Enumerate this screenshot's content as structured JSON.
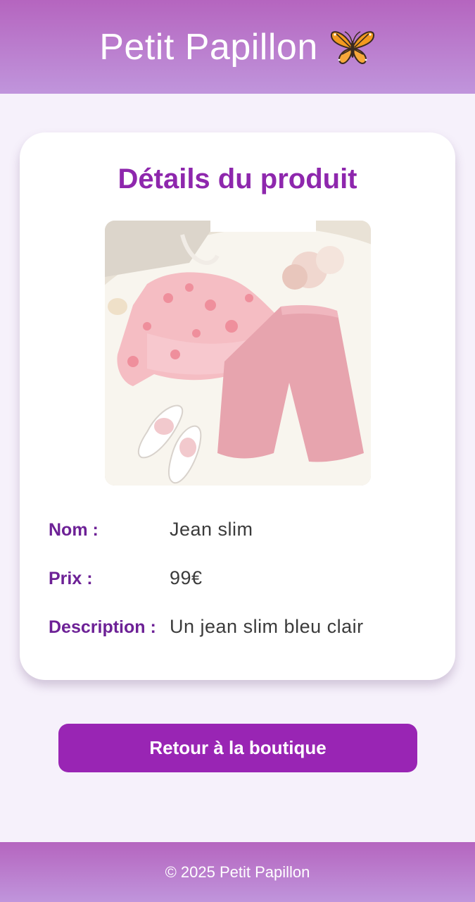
{
  "header": {
    "brand": "Petit Papillon",
    "icon": "butterfly-icon"
  },
  "product": {
    "title": "Détails du produit",
    "image_alt": "Ensemble rose : blouse en tulle à fleurs, pantalon rose et ballerines blanches",
    "name_label": "Nom :",
    "name_value": "Jean slim",
    "price_label": "Prix :",
    "price_value": "99€",
    "description_label": "Description :",
    "description_value": "Un jean slim bleu clair"
  },
  "actions": {
    "back_label": "Retour à la boutique"
  },
  "footer": {
    "copyright": "© 2025 Petit Papillon"
  },
  "colors": {
    "header_gradient_top": "#b565bf",
    "header_gradient_bottom": "#c095dc",
    "accent": "#9925b4",
    "title": "#8e27ad",
    "label": "#6d2196",
    "background": "#f6f1fb"
  }
}
